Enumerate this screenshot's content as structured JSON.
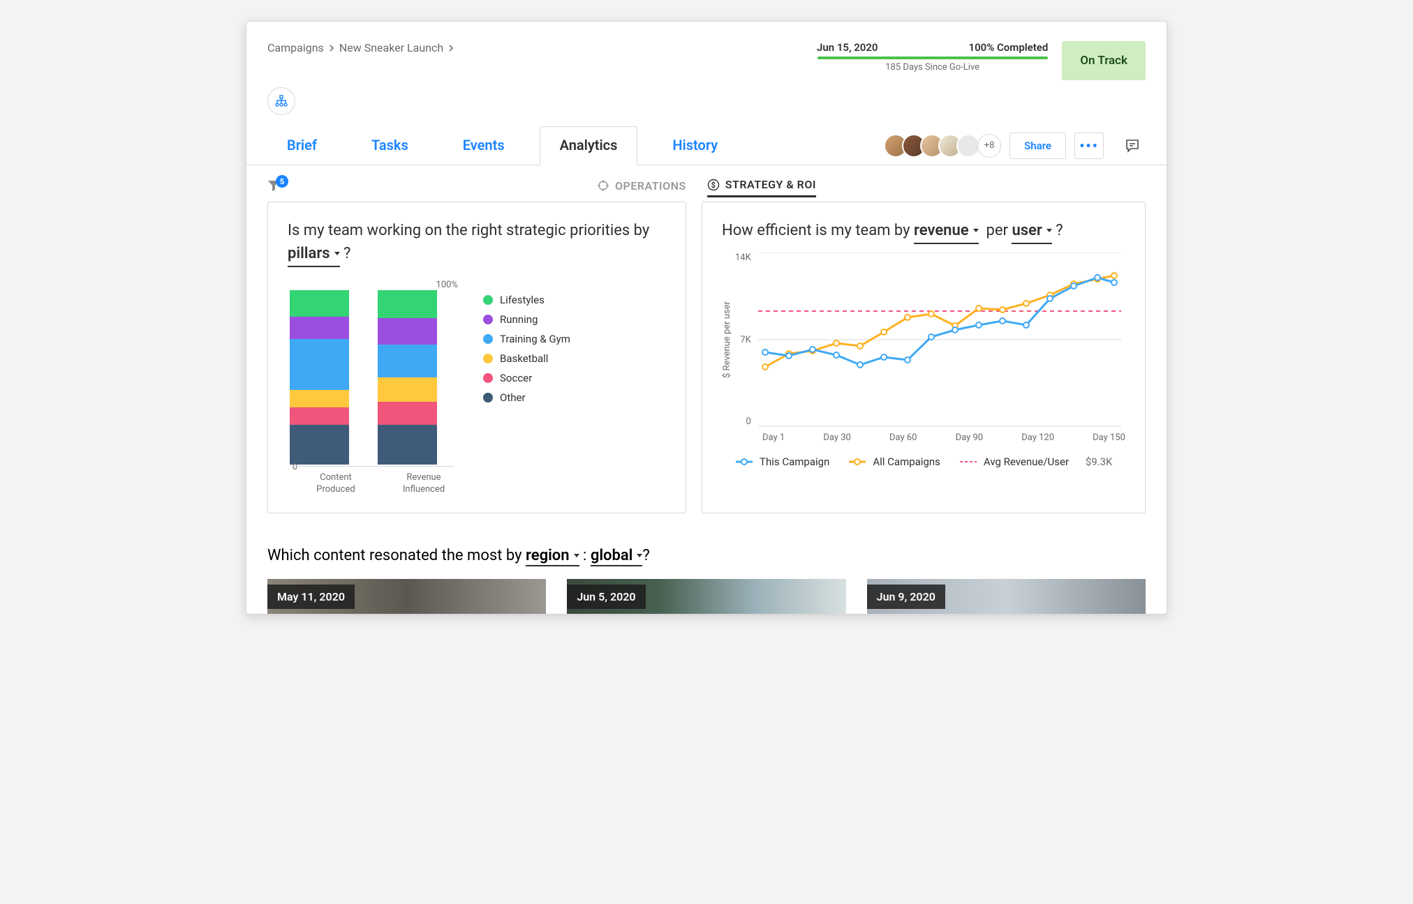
{
  "breadcrumbs": [
    "Campaigns",
    "New Sneaker Launch"
  ],
  "status": {
    "date": "Jun 15, 2020",
    "percent": "100% Completed",
    "days": "185 Days Since Go-Live",
    "track": "On Track"
  },
  "tabs": [
    "Brief",
    "Tasks",
    "Events",
    "Analytics",
    "History"
  ],
  "active_tab_index": 3,
  "avatars_plus": "+8",
  "share": "Share",
  "subtabs": {
    "ops": "OPERATIONS",
    "roi": "STRATEGY & ROI"
  },
  "filter_count": "5",
  "card1": {
    "title_pre": "Is my team working on the right strategic priorities by",
    "pillars": "pillars",
    "title_post": "?",
    "y100": "100%",
    "y0": "0",
    "col_labels": [
      "Content\nProduced",
      "Revenue\nInfluenced"
    ],
    "legend": [
      "Lifestyles",
      "Running",
      "Training & Gym",
      "Basketball",
      "Soccer",
      "Other"
    ]
  },
  "card2": {
    "title_pre": "How efficient is my team by",
    "revenue": "revenue",
    "per": "per",
    "user": "user",
    "q": "?",
    "ylabel": "$ Revenue per user",
    "yticks": [
      "14K",
      "7K",
      "0"
    ],
    "xticks": [
      "Day 1",
      "Day 30",
      "Day 60",
      "Day 90",
      "Day 120",
      "Day 150"
    ],
    "legend": {
      "this": "This Campaign",
      "all": "All Campaigns",
      "avg": "Avg Revenue/User",
      "avgval": "$9.3K"
    }
  },
  "bottom": {
    "title_pre": "Which content resonated the most by",
    "region": "region",
    "colon": ":",
    "global": "global",
    "q": "?",
    "dates": [
      "May 11, 2020",
      "Jun 5, 2020",
      "Jun 9, 2020"
    ]
  },
  "chart_data": [
    {
      "type": "bar",
      "title": "Is my team working on the right strategic priorities by pillars?",
      "categories": [
        "Content Produced",
        "Revenue Influenced"
      ],
      "stacked_percent": true,
      "ylim": [
        0,
        100
      ],
      "series": [
        {
          "name": "Lifestyles",
          "values": [
            15,
            16
          ],
          "color": "#33d473"
        },
        {
          "name": "Running",
          "values": [
            13,
            15
          ],
          "color": "#9b4fe0"
        },
        {
          "name": "Training & Gym",
          "values": [
            29,
            19
          ],
          "color": "#3fa9f5"
        },
        {
          "name": "Basketball",
          "values": [
            10,
            14
          ],
          "color": "#ffc83d"
        },
        {
          "name": "Soccer",
          "values": [
            10,
            13
          ],
          "color": "#f0567c"
        },
        {
          "name": "Other",
          "values": [
            23,
            23
          ],
          "color": "#3f5b7a"
        }
      ]
    },
    {
      "type": "line",
      "title": "How efficient is my team by revenue per user?",
      "ylabel": "$ Revenue per user",
      "ylim": [
        0,
        14000
      ],
      "reference_line": {
        "name": "Avg Revenue/User",
        "value": 9300
      },
      "x": [
        1,
        10,
        20,
        30,
        40,
        50,
        60,
        70,
        80,
        90,
        100,
        110,
        120,
        130,
        140,
        150
      ],
      "series": [
        {
          "name": "This Campaign",
          "values": [
            6000,
            5700,
            6200,
            5800,
            5000,
            5600,
            5400,
            7200,
            7800,
            8200,
            8500,
            8200,
            10300,
            11300,
            12000,
            11600
          ],
          "color": "#3fa9f5"
        },
        {
          "name": "All Campaigns",
          "values": [
            4800,
            5900,
            6100,
            6700,
            6500,
            7600,
            8800,
            9100,
            8100,
            9500,
            9400,
            9900,
            10600,
            11500,
            11900,
            12200
          ],
          "color": "#ffb020"
        }
      ]
    }
  ]
}
